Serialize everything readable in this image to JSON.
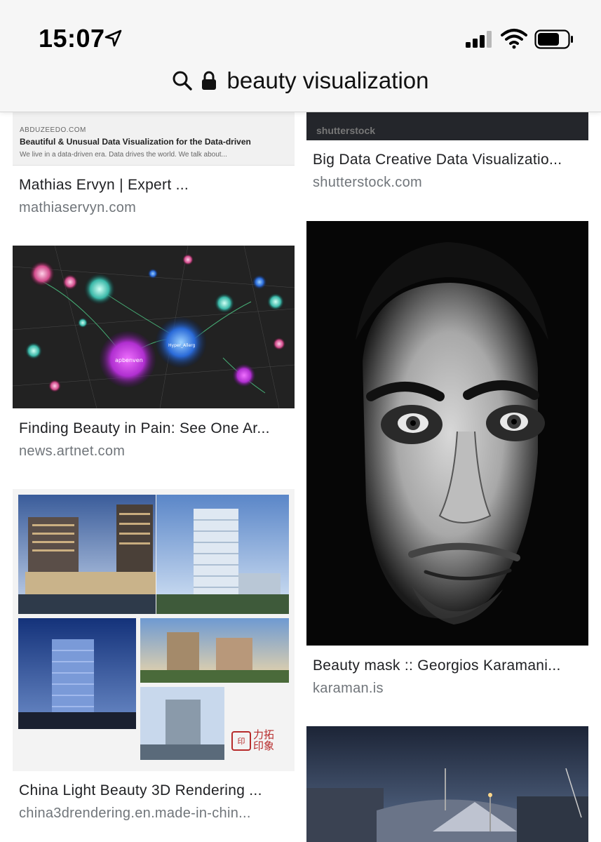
{
  "status_bar": {
    "time": "15:07"
  },
  "address_bar": {
    "query": "beauty visualization"
  },
  "results": [
    {
      "title": "Mathias Ervyn | Expert ...",
      "source": "mathiaservyn.com",
      "thumb_text": {
        "site": "ABDUZEEDO.COM",
        "headline": "Beautiful & Unusual Data Visualization for the Data-driven",
        "blurb": "We live in a data-driven era. Data drives the world. We talk about..."
      }
    },
    {
      "title": "Big Data Creative Data Visualizatio...",
      "source": "shutterstock.com",
      "thumb_text": {
        "watermark": "shutterstock"
      }
    },
    {
      "title": "Finding Beauty in Pain: See One Ar...",
      "source": "news.artnet.com",
      "thumb_text": {
        "node_a": "apbenven",
        "node_b": "Hyper_Allerg"
      }
    },
    {
      "title": "Beauty mask :: Georgios Karamani...",
      "source": "karaman.is"
    },
    {
      "title": "China Light Beauty 3D Rendering ...",
      "source": "china3drendering.en.made-in-chin...",
      "thumb_text": {
        "logo": "力拓印象"
      }
    },
    {
      "title": "",
      "source": ""
    }
  ],
  "colors": {
    "title_text": "#202124",
    "source_text": "#70757a",
    "bar_background": "#f6f6f6"
  },
  "icons": [
    "location-arrow-icon",
    "cellular-signal-icon",
    "wifi-icon",
    "battery-icon",
    "search-icon",
    "lock-icon"
  ]
}
